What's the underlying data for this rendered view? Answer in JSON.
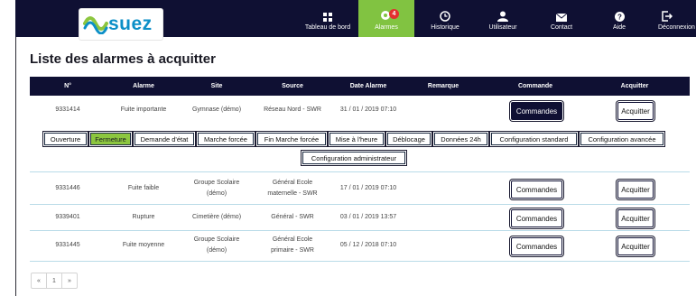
{
  "brand": {
    "name": "suez"
  },
  "nav": [
    {
      "label": "Tableau de bord",
      "icon": "dashboard-grid-icon"
    },
    {
      "label": "Alarmes",
      "icon": "alarm-icon",
      "badge": "4",
      "active": true
    },
    {
      "label": "Historique",
      "icon": "clock-icon"
    },
    {
      "label": "Utilisateur",
      "icon": "user-icon"
    },
    {
      "label": "Contact",
      "icon": "envelope-icon"
    },
    {
      "label": "Aide",
      "icon": "help-icon"
    },
    {
      "label": "Déconnexion",
      "icon": "logout-icon"
    }
  ],
  "page": {
    "title": "Liste des alarmes à acquitter"
  },
  "table": {
    "headers": [
      "N°",
      "Alarme",
      "Site",
      "Source",
      "Date Alarme",
      "Remarque",
      "Commande",
      "Acquitter"
    ],
    "command_label": "Commandes",
    "ack_label": "Acquitter",
    "rows": [
      {
        "num": "9331414",
        "alarm": "Fuite importante",
        "site_l1": "Gymnase (démo)",
        "site_l2": "",
        "source_l1": "Réseau Nord - SWR",
        "source_l2": "",
        "source_l3": "",
        "date": "31 / 01 / 2019 07:10",
        "remark": ""
      },
      {
        "num": "9331446",
        "alarm": "Fuite faible",
        "site_l1": "Groupe Scolaire",
        "site_l2": "(démo)",
        "source_l1": "Général Ecole",
        "source_l2": "maternelle - SWR",
        "source_l3": "",
        "date": "17 / 01 / 2019 07:10",
        "remark": ""
      },
      {
        "num": "9339401",
        "alarm": "Rupture",
        "site_l1": "Cimetière (démo)",
        "site_l2": "",
        "source_l1": "Général - SWR",
        "source_l2": "",
        "source_l3": "",
        "date": "03 / 01 / 2019 13:57",
        "remark": ""
      },
      {
        "num": "9331445",
        "alarm": "Fuite moyenne",
        "site_l1": "Groupe Scolaire",
        "site_l2": "(démo)",
        "source_l1": "Général Ecole",
        "source_l2": "primaire - SWR",
        "source_l3": "",
        "date": "05 / 12 / 2018 07:10",
        "remark": ""
      }
    ]
  },
  "commands": [
    {
      "label": "Ouverture"
    },
    {
      "label": "Fermeture",
      "active": true
    },
    {
      "label": "Demande d'état"
    },
    {
      "label": "Marche forcée"
    },
    {
      "label": "Fin Marche forcée"
    },
    {
      "label": "Mise à l'heure"
    },
    {
      "label": "Déblocage"
    },
    {
      "label": "Données 24h"
    },
    {
      "label": "Configuration standard"
    },
    {
      "label": "Configuration avancée"
    },
    {
      "label": "Configuration administrateur"
    }
  ],
  "pagination": {
    "prev": "«",
    "page": "1",
    "next": "»"
  },
  "colors": {
    "navy": "#0f1033",
    "green": "#81c341",
    "badge": "#e23030",
    "brand_blue": "#0c8fc7"
  }
}
